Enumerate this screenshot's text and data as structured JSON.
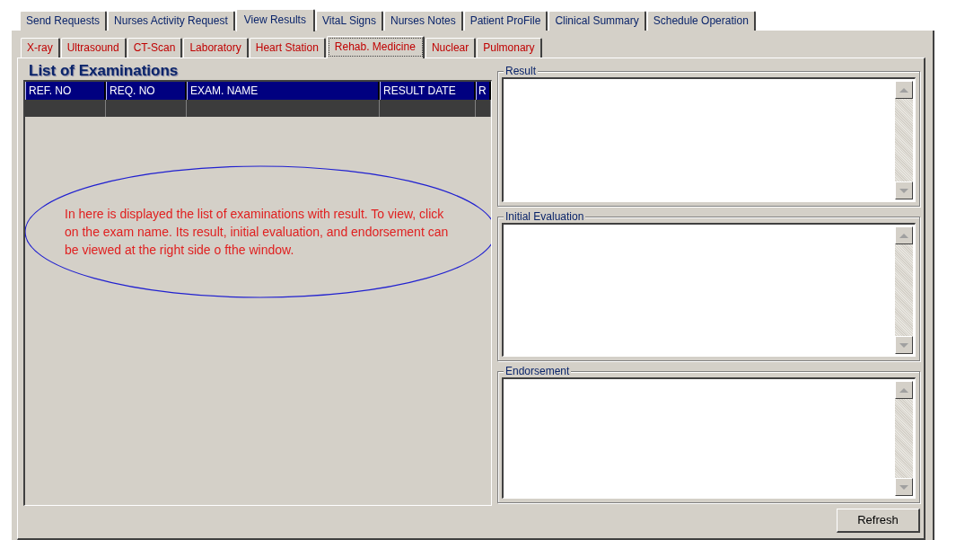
{
  "main_tabs": [
    {
      "label": "Send Requests",
      "selected": false
    },
    {
      "label": "Nurses Activity Request",
      "selected": false
    },
    {
      "label": "View  Results",
      "selected": true
    },
    {
      "label": "VitaL Signs",
      "selected": false
    },
    {
      "label": "Nurses Notes",
      "selected": false
    },
    {
      "label": "Patient ProFile",
      "selected": false
    },
    {
      "label": "Clinical Summary",
      "selected": false
    },
    {
      "label": "Schedule Operation",
      "selected": false
    }
  ],
  "sub_tabs": [
    {
      "label": "X-ray",
      "selected": false
    },
    {
      "label": "Ultrasound",
      "selected": false
    },
    {
      "label": "CT-Scan",
      "selected": false
    },
    {
      "label": "Laboratory",
      "selected": false
    },
    {
      "label": "Heart Station",
      "selected": false
    },
    {
      "label": "Rehab. Medicine",
      "selected": true
    },
    {
      "label": "Nuclear",
      "selected": false
    },
    {
      "label": "Pulmonary",
      "selected": false
    }
  ],
  "list": {
    "title": "List of Examinations",
    "columns": [
      "REF. NO",
      "REQ. NO",
      "EXAM. NAME",
      "RESULT DATE",
      "R"
    ],
    "annotation": "In here is displayed the list of examinations with result. To view, click on the exam name. Its result, initial evaluation, and endorsement can be viewed at the right side o fthe window."
  },
  "groups": [
    {
      "label": "Result"
    },
    {
      "label": "Initial Evaluation"
    },
    {
      "label": "Endorsement"
    }
  ],
  "buttons": [
    "Refresh"
  ]
}
